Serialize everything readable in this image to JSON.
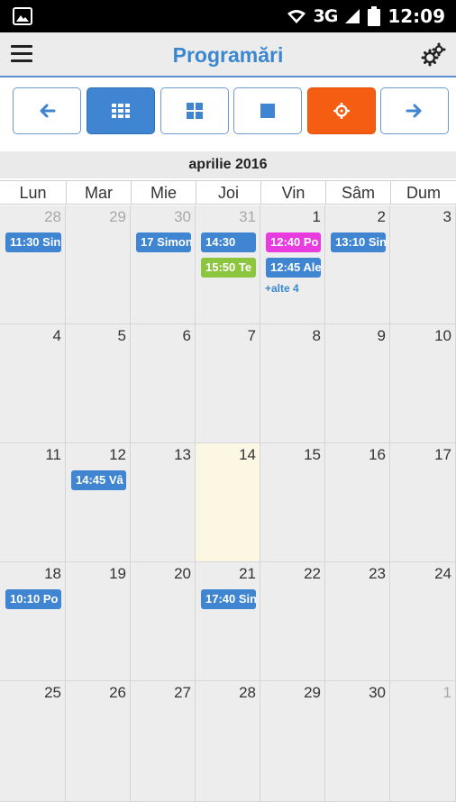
{
  "statusbar": {
    "network": "3G",
    "time": "12:09"
  },
  "header": {
    "title": "Programări",
    "menu_icon": "hamburger-icon",
    "settings_icon": "gears-icon"
  },
  "toolbar": {
    "buttons": [
      {
        "icon": "arrow-left-icon"
      },
      {
        "icon": "month-grid-icon",
        "active": true
      },
      {
        "icon": "week-grid-icon"
      },
      {
        "icon": "day-square-icon"
      },
      {
        "icon": "today-target-icon",
        "color": "#f45d12"
      },
      {
        "icon": "arrow-right-icon"
      }
    ]
  },
  "month_title": "aprilie 2016",
  "weekdays": [
    "Lun",
    "Mar",
    "Mie",
    "Joi",
    "Vin",
    "Sâm",
    "Dum"
  ],
  "weeks": [
    [
      {
        "day": "28",
        "other": true,
        "events": [
          {
            "text": "11:30 Sin",
            "color": "#3f85d2"
          }
        ]
      },
      {
        "day": "29",
        "other": true,
        "events": []
      },
      {
        "day": "30",
        "other": true,
        "events": [
          {
            "text": "17 Simon",
            "color": "#3f85d2"
          }
        ]
      },
      {
        "day": "31",
        "other": true,
        "events": [
          {
            "text": "14:30",
            "color": "#3f85d2"
          },
          {
            "text": "15:50 Te",
            "color": "#8cc63e"
          }
        ]
      },
      {
        "day": "1",
        "events": [
          {
            "text": "12:40 Po",
            "color": "#e83ce0"
          },
          {
            "text": "12:45 Ale",
            "color": "#3f85d2"
          }
        ],
        "more": "+alte 4"
      },
      {
        "day": "2",
        "events": [
          {
            "text": "13:10 Sin",
            "color": "#3f85d2"
          }
        ]
      },
      {
        "day": "3",
        "events": []
      }
    ],
    [
      {
        "day": "4",
        "events": []
      },
      {
        "day": "5",
        "events": []
      },
      {
        "day": "6",
        "events": []
      },
      {
        "day": "7",
        "events": []
      },
      {
        "day": "8",
        "events": []
      },
      {
        "day": "9",
        "events": []
      },
      {
        "day": "10",
        "events": []
      }
    ],
    [
      {
        "day": "11",
        "events": []
      },
      {
        "day": "12",
        "events": [
          {
            "text": "14:45 Vâ",
            "color": "#3f85d2"
          }
        ]
      },
      {
        "day": "13",
        "events": []
      },
      {
        "day": "14",
        "today": true,
        "events": []
      },
      {
        "day": "15",
        "events": []
      },
      {
        "day": "16",
        "events": []
      },
      {
        "day": "17",
        "events": []
      }
    ],
    [
      {
        "day": "18",
        "events": [
          {
            "text": "10:10 Po",
            "color": "#3f85d2"
          }
        ]
      },
      {
        "day": "19",
        "events": []
      },
      {
        "day": "20",
        "events": []
      },
      {
        "day": "21",
        "events": [
          {
            "text": "17:40 Sin",
            "color": "#3f85d2"
          }
        ]
      },
      {
        "day": "22",
        "events": []
      },
      {
        "day": "23",
        "events": []
      },
      {
        "day": "24",
        "events": []
      }
    ],
    [
      {
        "day": "25",
        "events": []
      },
      {
        "day": "26",
        "events": []
      },
      {
        "day": "27",
        "events": []
      },
      {
        "day": "28",
        "events": []
      },
      {
        "day": "29",
        "events": []
      },
      {
        "day": "30",
        "events": []
      },
      {
        "day": "1",
        "other": true,
        "events": []
      }
    ]
  ]
}
